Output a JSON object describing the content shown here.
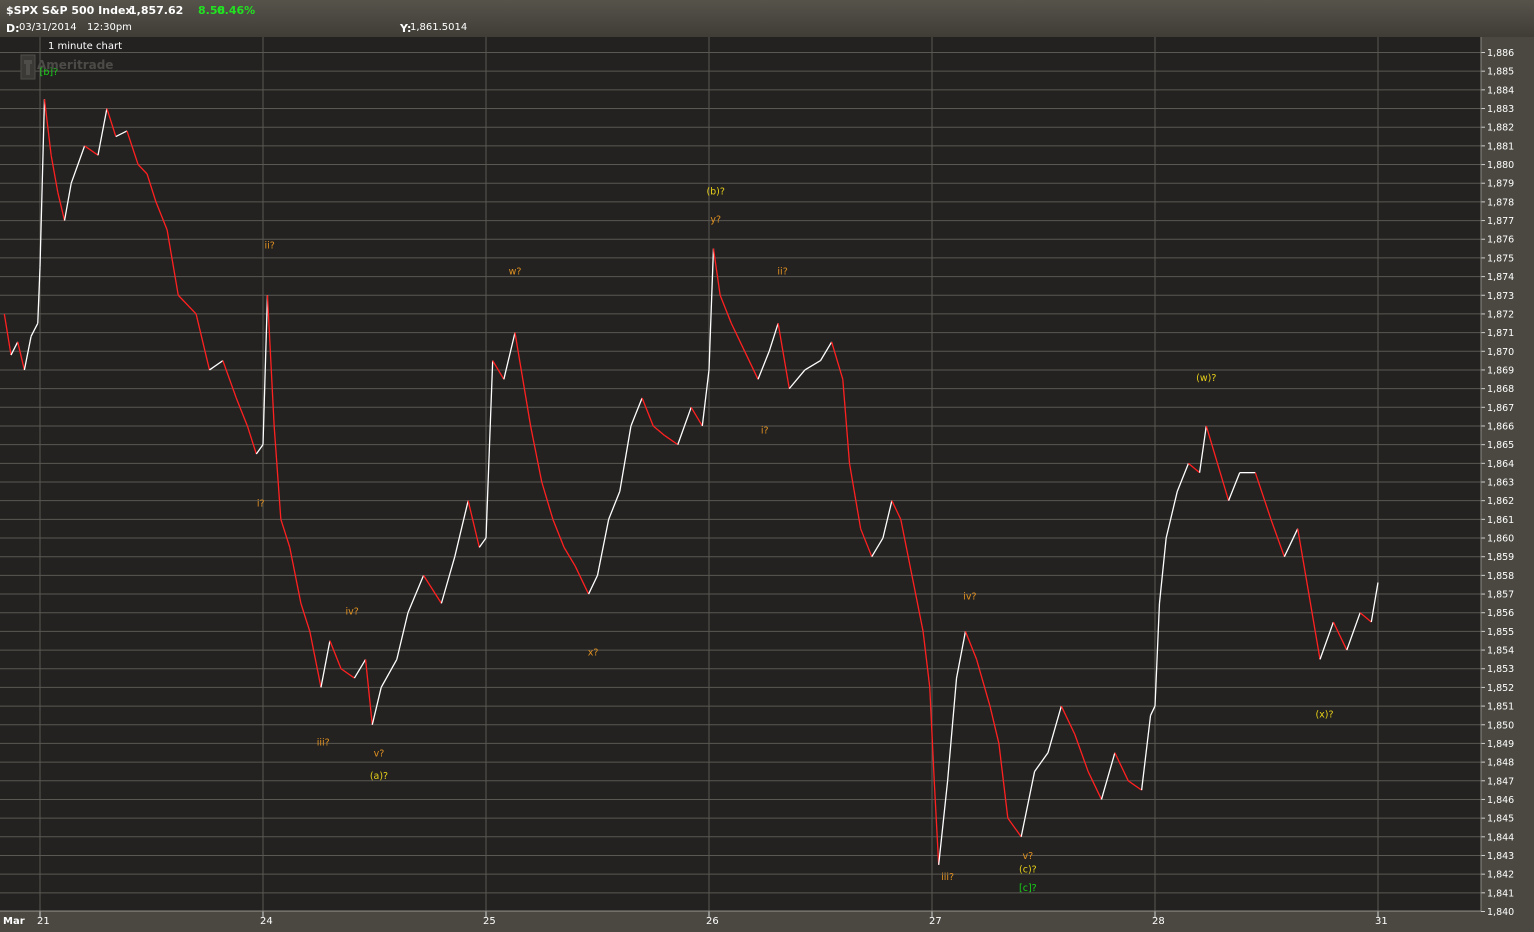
{
  "header": {
    "symbol": "$SPX S&P 500 Index",
    "last_price": "1,857.62",
    "change": "8.58",
    "change_pct": "0.46%",
    "date_label": "D:",
    "date": "03/31/2014",
    "time": "12:30pm",
    "y_label": "Y:",
    "y_value": "1,861.5014",
    "chart_caption": "1 minute chart",
    "watermark": "Ameritrade"
  },
  "colors": {
    "background": "#4a4840",
    "plot_background": "#232221",
    "grid": "#5a5852",
    "candle_up": "#ffffff",
    "candle_down": "#ff2020",
    "annotation_orange": "#e09020",
    "annotation_yellow": "#e8d018",
    "annotation_green": "#18d018",
    "change_green": "#22e022"
  },
  "chart_data": {
    "type": "line",
    "title": "$SPX S&P 500 Index",
    "interval": "1 minute",
    "ylim": [
      1840,
      1887
    ],
    "y_ticks": [
      "1,840",
      "1,841",
      "1,842",
      "1,843",
      "1,844",
      "1,845",
      "1,846",
      "1,847",
      "1,848",
      "1,849",
      "1,850",
      "1,851",
      "1,852",
      "1,853",
      "1,854",
      "1,855",
      "1,856",
      "1,857",
      "1,858",
      "1,859",
      "1,860",
      "1,861",
      "1,862",
      "1,863",
      "1,864",
      "1,865",
      "1,866",
      "1,867",
      "1,868",
      "1,869",
      "1,870",
      "1,871",
      "1,872",
      "1,873",
      "1,874",
      "1,875",
      "1,876",
      "1,877",
      "1,878",
      "1,879",
      "1,880",
      "1,881",
      "1,882",
      "1,883",
      "1,884",
      "1,885",
      "1,886"
    ],
    "x_ticks": [
      {
        "label": "Mar",
        "t": -1.5
      },
      {
        "label": "21",
        "t": 0
      },
      {
        "label": "24",
        "t": 1
      },
      {
        "label": "25",
        "t": 2
      },
      {
        "label": "26",
        "t": 3
      },
      {
        "label": "27",
        "t": 4
      },
      {
        "label": "28",
        "t": 5
      },
      {
        "label": "31",
        "t": 6
      }
    ],
    "grid": true,
    "series": [
      {
        "values": [
          [
            -0.16,
            1872.0
          ],
          [
            -0.13,
            1869.8
          ],
          [
            -0.1,
            1870.5
          ],
          [
            -0.07,
            1869.0
          ],
          [
            -0.04,
            1870.8
          ],
          [
            -0.01,
            1871.5
          ],
          [
            0.0,
            1874.5
          ],
          [
            0.02,
            1883.5
          ],
          [
            0.05,
            1880.5
          ],
          [
            0.08,
            1878.5
          ],
          [
            0.11,
            1877.0
          ],
          [
            0.14,
            1879.0
          ],
          [
            0.2,
            1881.0
          ],
          [
            0.26,
            1880.5
          ],
          [
            0.3,
            1883.0
          ],
          [
            0.34,
            1881.5
          ],
          [
            0.39,
            1881.8
          ],
          [
            0.44,
            1880.0
          ],
          [
            0.48,
            1879.5
          ],
          [
            0.52,
            1878.0
          ],
          [
            0.57,
            1876.5
          ],
          [
            0.62,
            1873.0
          ],
          [
            0.7,
            1872.0
          ],
          [
            0.76,
            1869.0
          ],
          [
            0.82,
            1869.5
          ],
          [
            0.88,
            1867.5
          ],
          [
            0.93,
            1866.0
          ],
          [
            0.97,
            1864.5
          ],
          [
            1.0,
            1865.0
          ],
          [
            1.02,
            1873.0
          ],
          [
            1.05,
            1866.0
          ],
          [
            1.08,
            1861.0
          ],
          [
            1.12,
            1859.5
          ],
          [
            1.17,
            1856.5
          ],
          [
            1.21,
            1855.0
          ],
          [
            1.26,
            1852.0
          ],
          [
            1.3,
            1854.5
          ],
          [
            1.35,
            1853.0
          ],
          [
            1.41,
            1852.5
          ],
          [
            1.46,
            1853.5
          ],
          [
            1.49,
            1850.0
          ],
          [
            1.53,
            1852.0
          ],
          [
            1.6,
            1853.5
          ],
          [
            1.65,
            1856.0
          ],
          [
            1.72,
            1858.0
          ],
          [
            1.8,
            1856.5
          ],
          [
            1.86,
            1859.0
          ],
          [
            1.92,
            1862.0
          ],
          [
            1.97,
            1859.5
          ],
          [
            2.0,
            1860.0
          ],
          [
            2.03,
            1869.5
          ],
          [
            2.08,
            1868.5
          ],
          [
            2.13,
            1871.0
          ],
          [
            2.2,
            1866.0
          ],
          [
            2.25,
            1863.0
          ],
          [
            2.3,
            1861.0
          ],
          [
            2.35,
            1859.5
          ],
          [
            2.4,
            1858.5
          ],
          [
            2.46,
            1857.0
          ],
          [
            2.5,
            1858.0
          ],
          [
            2.55,
            1861.0
          ],
          [
            2.6,
            1862.5
          ],
          [
            2.65,
            1866.0
          ],
          [
            2.7,
            1867.5
          ],
          [
            2.75,
            1866.0
          ],
          [
            2.8,
            1865.5
          ],
          [
            2.86,
            1865.0
          ],
          [
            2.92,
            1867.0
          ],
          [
            2.97,
            1866.0
          ],
          [
            3.0,
            1869.0
          ],
          [
            3.02,
            1875.5
          ],
          [
            3.05,
            1873.0
          ],
          [
            3.1,
            1871.5
          ],
          [
            3.16,
            1870.0
          ],
          [
            3.22,
            1868.5
          ],
          [
            3.27,
            1870.0
          ],
          [
            3.31,
            1871.5
          ],
          [
            3.36,
            1868.0
          ],
          [
            3.43,
            1869.0
          ],
          [
            3.5,
            1869.5
          ],
          [
            3.55,
            1870.5
          ],
          [
            3.6,
            1868.5
          ],
          [
            3.63,
            1864.0
          ],
          [
            3.68,
            1860.5
          ],
          [
            3.73,
            1859.0
          ],
          [
            3.78,
            1860.0
          ],
          [
            3.82,
            1862.0
          ],
          [
            3.86,
            1861.0
          ],
          [
            3.91,
            1858.0
          ],
          [
            3.96,
            1855.0
          ],
          [
            3.99,
            1852.0
          ],
          [
            4.01,
            1847.0
          ],
          [
            4.03,
            1842.5
          ],
          [
            4.07,
            1847.0
          ],
          [
            4.11,
            1852.5
          ],
          [
            4.15,
            1855.0
          ],
          [
            4.2,
            1853.5
          ],
          [
            4.26,
            1851.0
          ],
          [
            4.3,
            1849.0
          ],
          [
            4.34,
            1845.0
          ],
          [
            4.4,
            1844.0
          ],
          [
            4.46,
            1847.5
          ],
          [
            4.52,
            1848.5
          ],
          [
            4.58,
            1851.0
          ],
          [
            4.64,
            1849.5
          ],
          [
            4.7,
            1847.5
          ],
          [
            4.76,
            1846.0
          ],
          [
            4.82,
            1848.5
          ],
          [
            4.88,
            1847.0
          ],
          [
            4.94,
            1846.5
          ],
          [
            4.98,
            1850.5
          ],
          [
            5.0,
            1851.0
          ],
          [
            5.02,
            1856.5
          ],
          [
            5.05,
            1860.0
          ],
          [
            5.1,
            1862.5
          ],
          [
            5.15,
            1864.0
          ],
          [
            5.2,
            1863.5
          ],
          [
            5.23,
            1866.0
          ],
          [
            5.28,
            1864.0
          ],
          [
            5.33,
            1862.0
          ],
          [
            5.38,
            1863.5
          ],
          [
            5.45,
            1863.5
          ],
          [
            5.52,
            1861.0
          ],
          [
            5.58,
            1859.0
          ],
          [
            5.64,
            1860.5
          ],
          [
            5.69,
            1857.0
          ],
          [
            5.74,
            1853.5
          ],
          [
            5.8,
            1855.5
          ],
          [
            5.86,
            1854.0
          ],
          [
            5.92,
            1856.0
          ],
          [
            5.97,
            1855.5
          ],
          [
            6.0,
            1857.62
          ]
        ]
      }
    ],
    "annotations": [
      {
        "text": "[b]?",
        "t": 0.04,
        "y": 1884.8,
        "color": "green"
      },
      {
        "text": "ii?",
        "t": 1.03,
        "y": 1875.5,
        "color": "orange"
      },
      {
        "text": "i?",
        "t": 0.99,
        "y": 1861.7,
        "color": "orange"
      },
      {
        "text": "iv?",
        "t": 1.4,
        "y": 1855.9,
        "color": "orange"
      },
      {
        "text": "iii?",
        "t": 1.27,
        "y": 1848.9,
        "color": "orange"
      },
      {
        "text": "v?",
        "t": 1.52,
        "y": 1848.3,
        "color": "orange"
      },
      {
        "text": "(a)?",
        "t": 1.52,
        "y": 1847.1,
        "color": "yellow"
      },
      {
        "text": "w?",
        "t": 2.13,
        "y": 1874.1,
        "color": "orange"
      },
      {
        "text": "x?",
        "t": 2.48,
        "y": 1853.7,
        "color": "orange"
      },
      {
        "text": "(b)?",
        "t": 3.03,
        "y": 1878.4,
        "color": "yellow"
      },
      {
        "text": "y?",
        "t": 3.03,
        "y": 1876.9,
        "color": "orange"
      },
      {
        "text": "ii?",
        "t": 3.33,
        "y": 1874.1,
        "color": "orange"
      },
      {
        "text": "i?",
        "t": 3.25,
        "y": 1865.6,
        "color": "orange"
      },
      {
        "text": "iv?",
        "t": 4.17,
        "y": 1856.7,
        "color": "orange"
      },
      {
        "text": "iii?",
        "t": 4.07,
        "y": 1841.7,
        "color": "orange"
      },
      {
        "text": "v?",
        "t": 4.43,
        "y": 1842.8,
        "color": "orange"
      },
      {
        "text": "(c)?",
        "t": 4.43,
        "y": 1842.1,
        "color": "yellow"
      },
      {
        "text": "[c]?",
        "t": 4.43,
        "y": 1841.1,
        "color": "green"
      },
      {
        "text": "(w)?",
        "t": 5.23,
        "y": 1868.4,
        "color": "yellow"
      },
      {
        "text": "(x)?",
        "t": 5.76,
        "y": 1850.4,
        "color": "yellow"
      }
    ]
  }
}
